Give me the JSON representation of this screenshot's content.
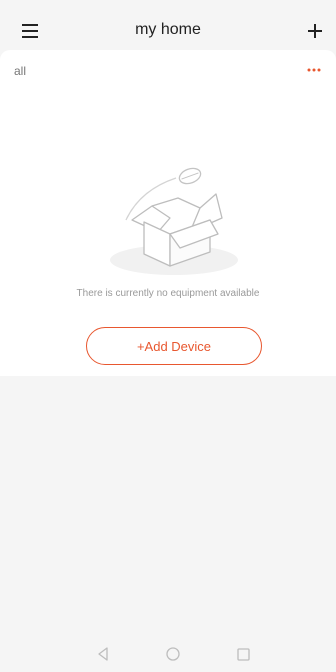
{
  "header": {
    "title": "my home",
    "menu_icon": "hamburger-menu-icon",
    "add_icon": "plus-icon"
  },
  "filter": {
    "label": "all",
    "more_icon": "more-dots-icon"
  },
  "empty_state": {
    "illustration_icon": "empty-box-icon",
    "message": "There is currently no equipment available",
    "add_button_label": "+Add Device"
  },
  "system_nav": {
    "back_icon": "back-triangle-icon",
    "home_icon": "home-circle-icon",
    "recents_icon": "recents-square-icon"
  },
  "colors": {
    "accent": "#e8572f",
    "background": "#f5f5f5",
    "card": "#ffffff",
    "text_primary": "#222222",
    "text_secondary": "#9a9a9a"
  }
}
